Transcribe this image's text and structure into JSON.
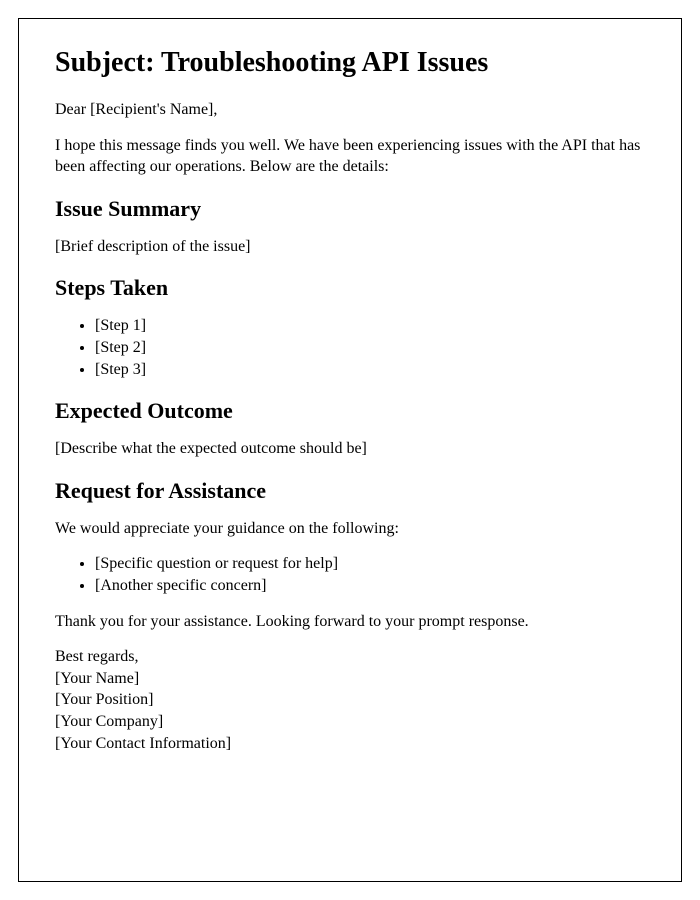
{
  "subject_heading": "Subject: Troubleshooting API Issues",
  "greeting": "Dear [Recipient's Name],",
  "intro": "I hope this message finds you well. We have been experiencing issues with the API that has been affecting our operations. Below are the details:",
  "issue_summary": {
    "heading": "Issue Summary",
    "body": "[Brief description of the issue]"
  },
  "steps_taken": {
    "heading": "Steps Taken",
    "items": [
      "[Step 1]",
      "[Step 2]",
      "[Step 3]"
    ]
  },
  "expected_outcome": {
    "heading": "Expected Outcome",
    "body": "[Describe what the expected outcome should be]"
  },
  "request_assistance": {
    "heading": "Request for Assistance",
    "intro": "We would appreciate your guidance on the following:",
    "items": [
      "[Specific question or request for help]",
      "[Another specific concern]"
    ]
  },
  "thanks": "Thank you for your assistance. Looking forward to your prompt response.",
  "signoff": {
    "regards": "Best regards,",
    "name": "[Your Name]",
    "position": "[Your Position]",
    "company": "[Your Company]",
    "contact": "[Your Contact Information]"
  }
}
